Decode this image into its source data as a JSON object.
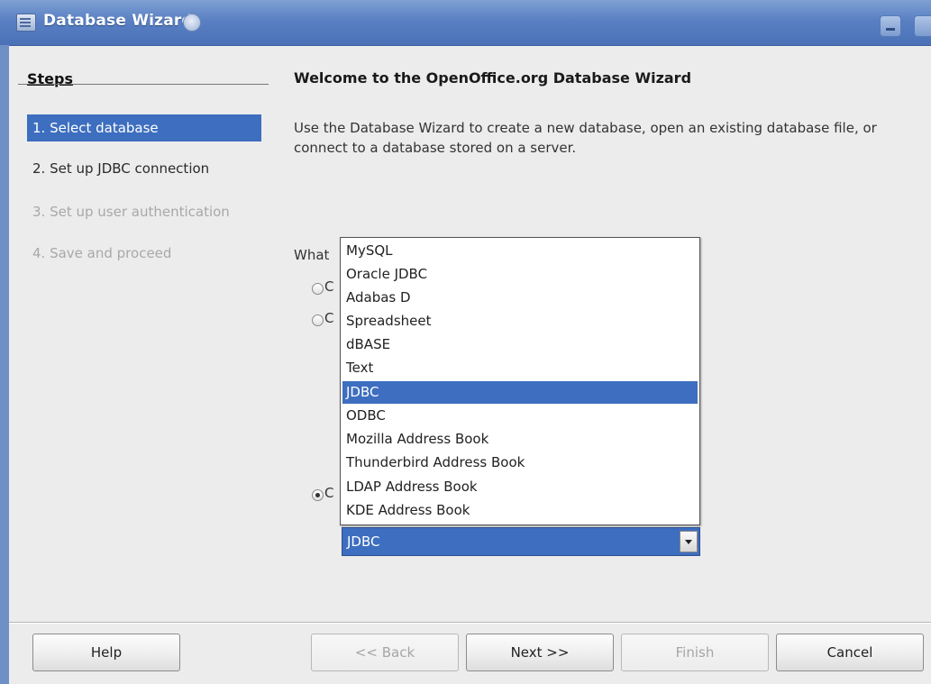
{
  "window": {
    "title": "Database Wizard",
    "icons": [
      "app-icon",
      "lock-icon",
      "minimize-icon",
      "maximize-icon"
    ]
  },
  "steps": {
    "heading": "Steps",
    "items": [
      {
        "label": "1. Select database",
        "state": "active"
      },
      {
        "label": "2. Set up JDBC connection",
        "state": "normal"
      },
      {
        "label": "3. Set up user authentication",
        "state": "disabled"
      },
      {
        "label": "4. Save and proceed",
        "state": "disabled"
      }
    ]
  },
  "main": {
    "title": "Welcome to the OpenOffice.org Database Wizard",
    "description": "Use the Database Wizard to create a new database, open an existing database file, or connect to a database stored on a server.",
    "question_label": "What",
    "radio_options": [
      {
        "letter": "C",
        "checked": false
      },
      {
        "letter": "C",
        "checked": false
      },
      {
        "letter": "C",
        "checked": true
      }
    ]
  },
  "dropdown": {
    "options": [
      "MySQL",
      "Oracle JDBC",
      "Adabas D",
      "Spreadsheet",
      "dBASE",
      "Text",
      "JDBC",
      "ODBC",
      "Mozilla Address Book",
      "Thunderbird Address Book",
      "LDAP Address Book",
      "KDE Address Book"
    ],
    "highlighted": "JDBC",
    "selected_value": "JDBC"
  },
  "buttons": {
    "help": "Help",
    "back": "<< Back",
    "next": "Next >>",
    "finish": "Finish",
    "cancel": "Cancel"
  },
  "colors": {
    "selection": "#3d6ebf",
    "titlebar": "#5a80c4",
    "disabled_text": "#a8a8a8"
  }
}
